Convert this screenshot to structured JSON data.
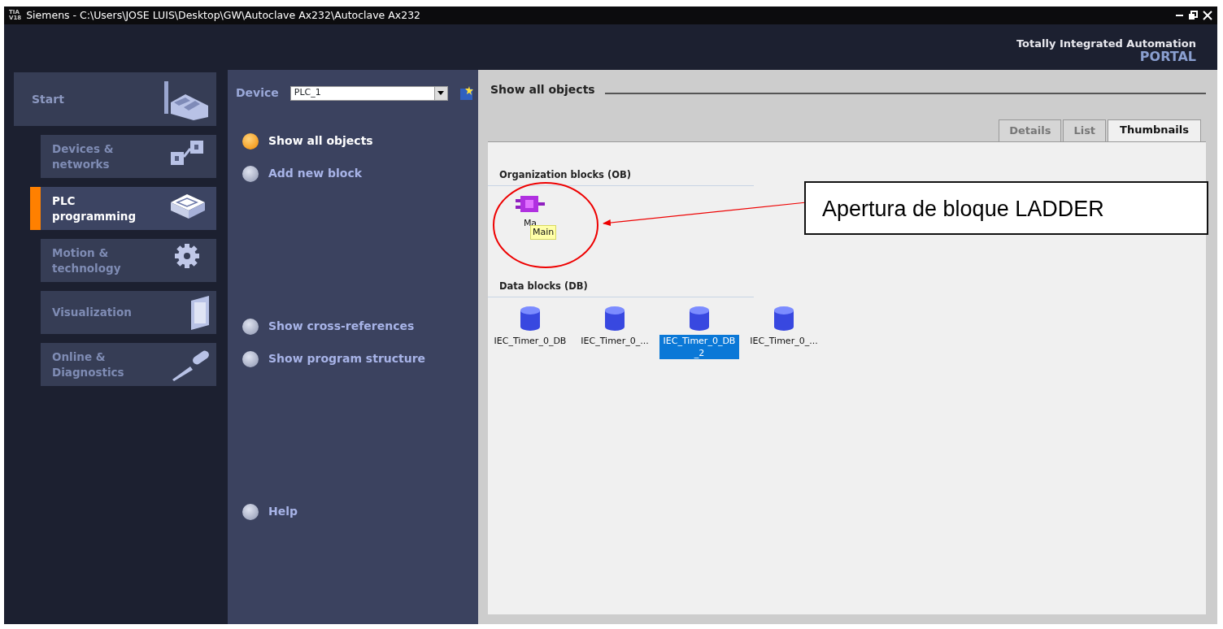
{
  "window": {
    "logo": [
      "TIA",
      "V18"
    ],
    "title": "Siemens  -  C:\\Users\\JOSE LUIS\\Desktop\\GW\\Autoclave Ax232\\Autoclave Ax232"
  },
  "brand": {
    "line1": "Totally Integrated Automation",
    "line2": "PORTAL"
  },
  "sidebar": {
    "start": "Start",
    "items": [
      {
        "label": "Devices & networks",
        "kind": "devices",
        "selected": false
      },
      {
        "label": "PLC programming",
        "kind": "plc",
        "selected": true
      },
      {
        "label": "Motion & technology",
        "kind": "gear",
        "selected": false
      },
      {
        "label": "Visualization",
        "kind": "panel",
        "selected": false
      },
      {
        "label": "Online & Diagnostics",
        "kind": "screwdriver",
        "selected": false
      }
    ]
  },
  "device": {
    "label": "Device",
    "value": "PLC_1"
  },
  "actions": [
    [
      {
        "label": "Show all objects",
        "selected": true
      },
      {
        "label": "Add new block",
        "selected": false
      }
    ],
    [
      {
        "label": "Show cross-references",
        "selected": false
      },
      {
        "label": "Show program structure",
        "selected": false
      }
    ],
    [
      {
        "label": "Help",
        "selected": false
      }
    ]
  ],
  "content": {
    "title": "Show all objects",
    "tabs": [
      {
        "label": "Details",
        "selected": false
      },
      {
        "label": "List",
        "selected": false
      },
      {
        "label": "Thumbnails",
        "selected": true
      }
    ],
    "groups": [
      {
        "title": "Organization blocks (OB)",
        "kind": "ob",
        "items": [
          {
            "label": "Ma",
            "selected": false,
            "tooltip": "Main"
          }
        ]
      },
      {
        "title": "Data blocks (DB)",
        "kind": "db",
        "items": [
          {
            "label": "IEC_Timer_0_DB",
            "selected": false
          },
          {
            "label": "IEC_Timer_0_...",
            "selected": false
          },
          {
            "label": "IEC_Timer_0_DB _2",
            "selected": true
          },
          {
            "label": "IEC_Timer_0_...",
            "selected": false
          }
        ]
      }
    ]
  },
  "annotation": {
    "text": "Apertura de bloque LADDER"
  }
}
